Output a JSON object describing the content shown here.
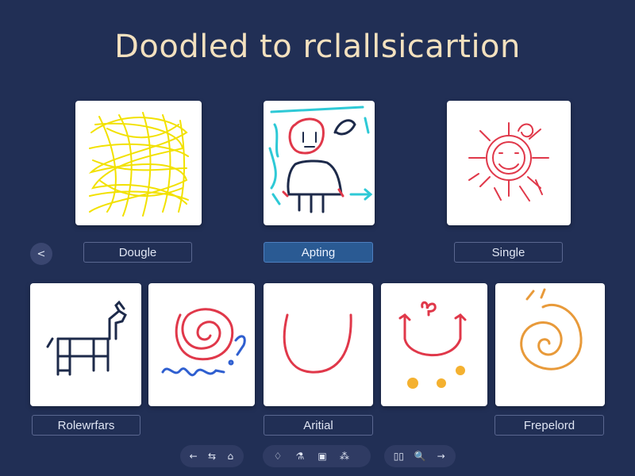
{
  "title": "Doodled to rclallsicartion",
  "back_button": "<",
  "top_row": {
    "labels": [
      "Dougle",
      "Apting",
      "Single"
    ],
    "active_index": 1
  },
  "bottom_row": {
    "labels": [
      "Rolewrfars",
      "Aritial",
      "Frepelord"
    ]
  },
  "toolbar": {
    "group1": [
      "←",
      "⇆",
      "⌂"
    ],
    "group2": [
      "♢",
      "⚗",
      "▣",
      "⁂"
    ],
    "group3": [
      "▯▯",
      "🔍",
      "→"
    ]
  },
  "colors": {
    "background": "#212f55",
    "title": "#f3e1bf",
    "active_label": "#2a5a93",
    "yellow_scribble": "#f2e100",
    "red": "#e0384a",
    "cyan": "#2ec9d6",
    "navy": "#1d2a4a",
    "blue": "#2f5fd0",
    "orange": "#e89a3a"
  }
}
